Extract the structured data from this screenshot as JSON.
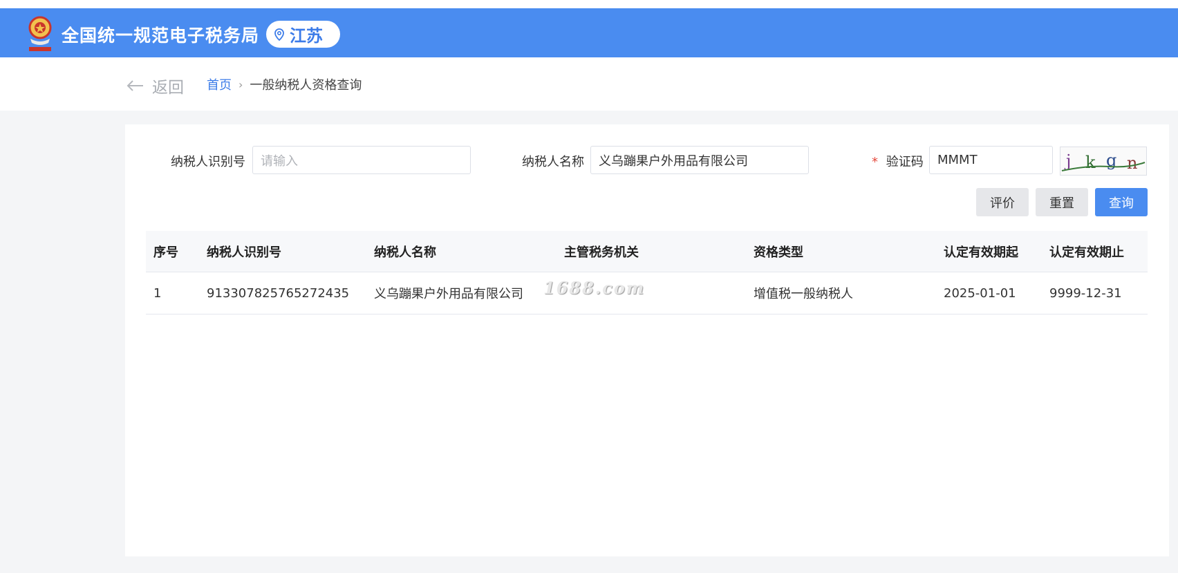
{
  "header": {
    "site_title": "全国统一规范电子税务局",
    "region": "江苏",
    "background_color": "#4a8cf0"
  },
  "nav": {
    "back_label": "返回",
    "breadcrumb_home": "首页",
    "breadcrumb_separator": "›",
    "breadcrumb_current": "一般纳税人资格查询"
  },
  "form": {
    "taxpayer_id_label": "纳税人识别号",
    "taxpayer_id_placeholder": "请输入",
    "taxpayer_name_label": "纳税人名称",
    "taxpayer_name_value": "义乌蹦果户外用品有限公司",
    "captcha_required_mark": "*",
    "captcha_label": "验证码",
    "captcha_value": "MMMT",
    "captcha_image_text": "jkgn"
  },
  "buttons": {
    "evaluate": "评价",
    "reset": "重置",
    "query": "查询"
  },
  "table": {
    "columns": [
      "序号",
      "纳税人识别号",
      "纳税人名称",
      "主管税务机关",
      "资格类型",
      "认定有效期起",
      "认定有效期止"
    ],
    "rows": [
      [
        "1",
        "913307825765272435",
        "义乌蹦果户外用品有限公司",
        "",
        "增值税一般纳税人",
        "2025-01-01",
        "9999-12-31"
      ]
    ]
  },
  "watermark": "1688.com"
}
